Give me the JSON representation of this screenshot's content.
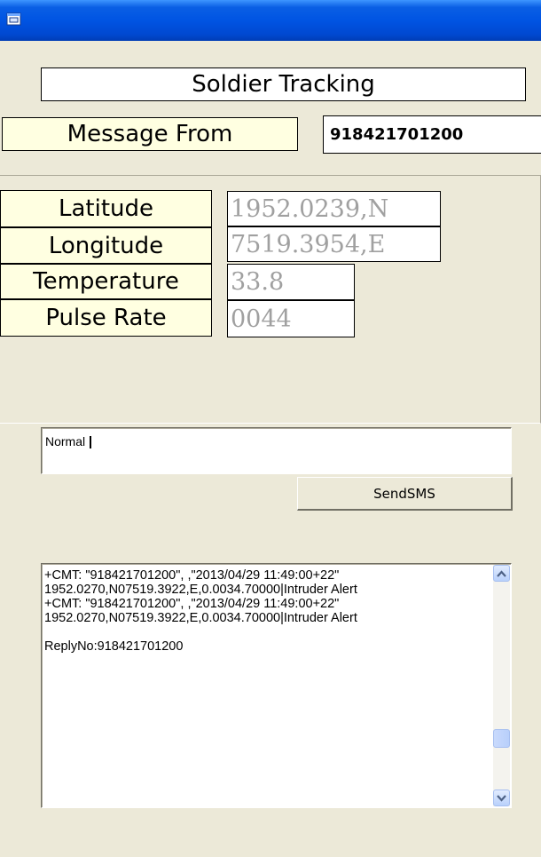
{
  "window": {
    "title": "",
    "icon": "app-window-icon",
    "titlebar_color": "#0054e3",
    "background_color": "#ece9d8"
  },
  "header": {
    "title": "Soldier Tracking",
    "message_from_label": "Message From",
    "message_from_value": "918421701200"
  },
  "readings": [
    {
      "label": "Latitude",
      "value": "1952.0239,N"
    },
    {
      "label": "Longitude",
      "value": "7519.3954,E"
    },
    {
      "label": "Temperature",
      "value": "33.8"
    },
    {
      "label": "Pulse Rate",
      "value": "0044"
    }
  ],
  "sms": {
    "message_value": "Normal",
    "send_label": "SendSMS"
  },
  "log": {
    "text": "+CMT: \"918421701200\", ,\"2013/04/29 11:49:00+22\"\n1952.0270,N07519.3922,E,0.0034.70000|Intruder Alert\n+CMT: \"918421701200\", ,\"2013/04/29 11:49:00+22\"\n1952.0270,N07519.3922,E,0.0034.70000|Intruder Alert\n\nReplyNo:918421701200",
    "scroll_up_icon": "chevron-up-icon",
    "scroll_down_icon": "chevron-down-icon"
  }
}
